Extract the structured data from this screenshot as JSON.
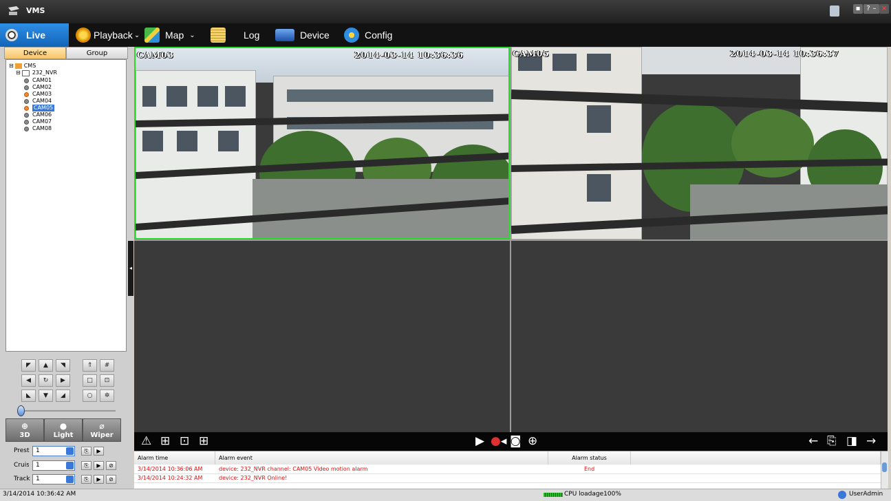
{
  "app": {
    "title": "VMS"
  },
  "menu": [
    {
      "label": "Live"
    },
    {
      "label": "Playback"
    },
    {
      "label": "Map"
    },
    {
      "label": "Log"
    },
    {
      "label": "Device"
    },
    {
      "label": "Config"
    }
  ],
  "left_tabs": [
    "Device",
    "Group"
  ],
  "tree": {
    "root": "CMS",
    "nvr": "232_NVR",
    "cameras": [
      "CAM01",
      "CAM02",
      "CAM03",
      "CAM04",
      "CAM05",
      "CAM06",
      "CAM07",
      "CAM08"
    ],
    "active_cameras": [
      "CAM03",
      "CAM05"
    ],
    "selected": "CAM05"
  },
  "ptz": {
    "buttons": [
      "3D",
      "Light",
      "Wiper"
    ],
    "preset_label": "Prest",
    "cruise_label": "Cruise",
    "track_label": "Track",
    "preset_value": "1",
    "cruise_value": "1",
    "track_value": "1"
  },
  "video": {
    "pane1": {
      "cam": "CAM03",
      "timestamp": "2014-03-14 10:36:36"
    },
    "pane2": {
      "cam": "CAM05",
      "timestamp": "2014-03-14 10:36:37"
    }
  },
  "alarm_table": {
    "headers": [
      "Alarm time",
      "Alarm event",
      "Alarm status"
    ],
    "rows": [
      {
        "time": "3/14/2014 10:36:06 AM",
        "event": "device: 232_NVR   channel: CAM05   Video motion alarm",
        "status": "End"
      },
      {
        "time": "3/14/2014 10:24:32 AM",
        "event": "device: 232_NVR   Online!",
        "status": ""
      }
    ]
  },
  "status": {
    "datetime": "3/14/2014 10:36:42 AM",
    "cpu": "CPU loadage100%",
    "user": "UserAdmin"
  },
  "colors": {
    "accent": "#1e7fd6",
    "selected_pane_border": "#2bd82b",
    "alarm_text": "#e01010"
  }
}
